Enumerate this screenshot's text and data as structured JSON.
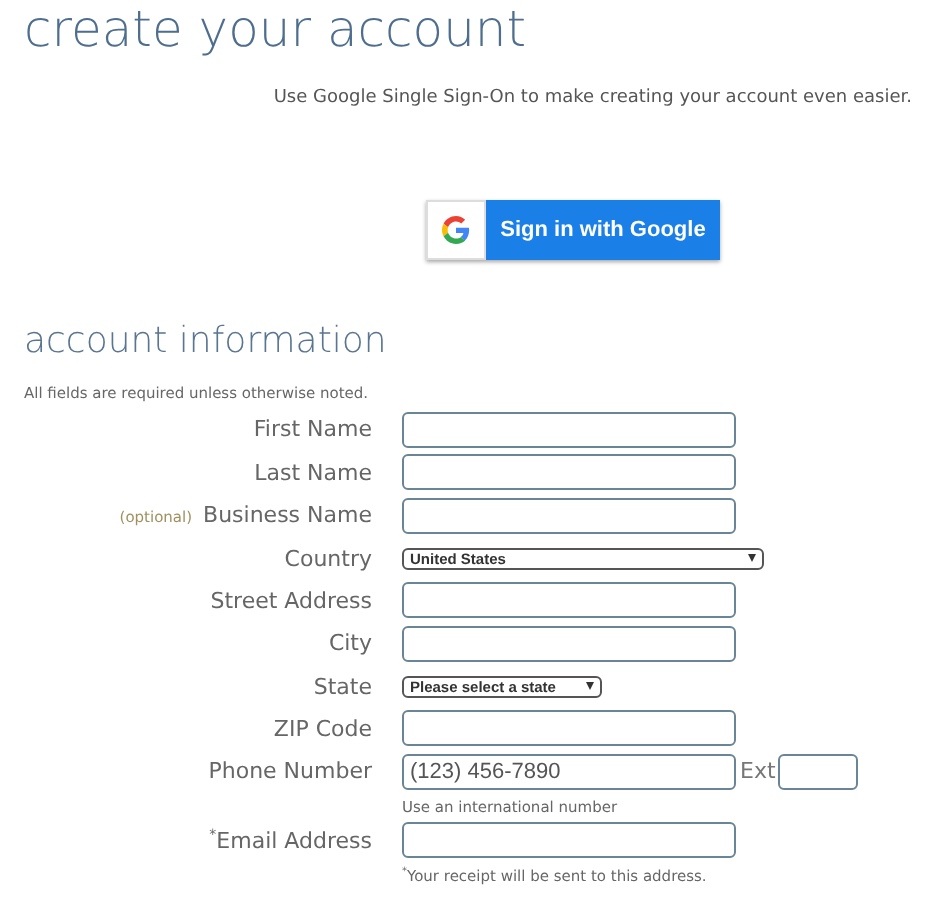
{
  "page_title": "create your account",
  "sso": {
    "note": "Use Google Single Sign-On to make creating your account even easier.",
    "button": "Sign in with Google"
  },
  "section": {
    "title": "account information",
    "note": "All fields are required unless otherwise noted."
  },
  "fields": [
    {
      "kind": "text",
      "label": "First Name"
    },
    {
      "kind": "text",
      "label": "Last Name"
    },
    {
      "kind": "text",
      "label": "Business Name",
      "optional": "(optional)"
    },
    {
      "kind": "select",
      "label": "Country",
      "value": "United States",
      "wide": true
    },
    {
      "kind": "text",
      "label": "Street Address"
    },
    {
      "kind": "text",
      "label": "City"
    },
    {
      "kind": "select",
      "label": "State",
      "value": "Please select a state",
      "wide": false
    },
    {
      "kind": "text",
      "label": "ZIP Code"
    },
    {
      "kind": "text",
      "label": "Phone Number",
      "placeholder": "(123) 456-7890",
      "ext": "Ext",
      "hint": "Use an international number"
    },
    {
      "kind": "text",
      "label": "$^{*}$Email Address",
      "hint": "$^{*}$Your receipt will be sent to this address."
    }
  ]
}
